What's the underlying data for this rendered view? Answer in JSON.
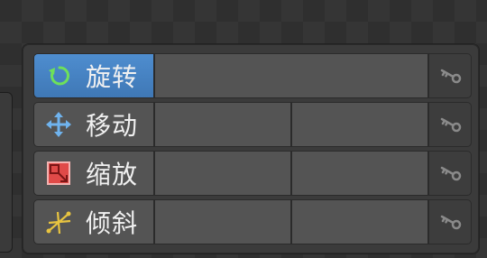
{
  "tools": [
    {
      "label": "旋转",
      "icon": "rotate-icon",
      "active": true
    },
    {
      "label": "移动",
      "icon": "move-icon",
      "active": false
    },
    {
      "label": "缩放",
      "icon": "scale-icon",
      "active": false
    },
    {
      "label": "倾斜",
      "icon": "shear-icon",
      "active": false
    }
  ],
  "colors": {
    "active": "#4a85c4",
    "button": "#545454",
    "field": "#545454",
    "panel": "#3b3b3b"
  }
}
